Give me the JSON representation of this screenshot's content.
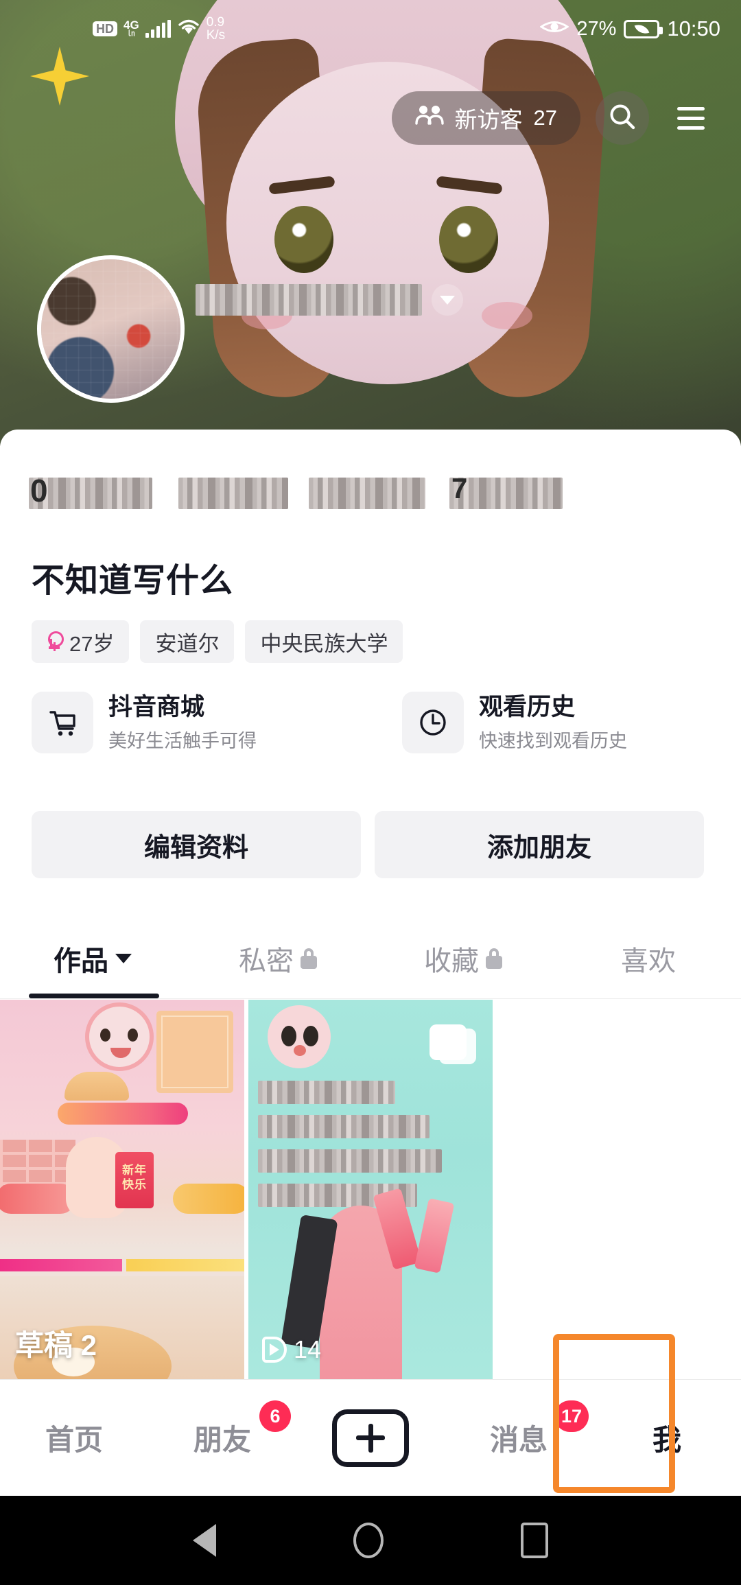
{
  "status_bar": {
    "hd_label": "HD",
    "network": "4G",
    "network_sub": "㏑",
    "speed_value": "0.9",
    "speed_unit": "K/s",
    "eye_icon": "eye-icon",
    "battery_percent": "27%",
    "battery_icon": "battery-eco-icon",
    "clock": "10:50"
  },
  "header": {
    "visitor_label": "新访客",
    "visitor_count": "27",
    "visitor_icon": "people-icon",
    "search_icon": "search-icon",
    "menu_icon": "hamburger-menu-icon",
    "username_masked": "",
    "username_caret_icon": "chevron-down-icon",
    "avatar_name": "profile-avatar"
  },
  "profile": {
    "stats_masked": [
      "",
      "",
      "",
      ""
    ],
    "stats_glyph_first": "0",
    "stats_glyph_last": "7",
    "bio": "不知道写什么",
    "tags": [
      {
        "icon": "female-gender-icon",
        "label": "27岁"
      },
      {
        "icon": "",
        "label": "安道尔"
      },
      {
        "icon": "",
        "label": "中央民族大学"
      }
    ]
  },
  "shortcuts": [
    {
      "icon": "shopping-cart-icon",
      "title": "抖音商城",
      "subtitle": "美好生活触手可得"
    },
    {
      "icon": "clock-icon",
      "title": "观看历史",
      "subtitle": "快速找到观看历史"
    }
  ],
  "actions": [
    {
      "label": "编辑资料"
    },
    {
      "label": "添加朋友"
    }
  ],
  "tabs": [
    {
      "label": "作品",
      "active": true,
      "icon": "chevron-down-icon",
      "locked": false
    },
    {
      "label": "私密",
      "active": false,
      "icon": "lock-icon",
      "locked": true
    },
    {
      "label": "收藏",
      "active": false,
      "icon": "lock-icon",
      "locked": true
    },
    {
      "label": "喜欢",
      "active": false,
      "icon": "",
      "locked": false
    }
  ],
  "grid": {
    "items": [
      {
        "label": "草稿 2",
        "type": "draft",
        "envelope_text": "新年\n快乐"
      },
      {
        "label": "14",
        "type": "video",
        "play_icon": "play-icon"
      }
    ]
  },
  "bottom_nav": {
    "items": [
      {
        "label": "首页",
        "badge": "",
        "active": false
      },
      {
        "label": "朋友",
        "badge": "6",
        "active": false
      },
      {
        "label": "",
        "badge": "",
        "active": false,
        "icon": "plus-icon"
      },
      {
        "label": "消息",
        "badge": "17",
        "active": false
      },
      {
        "label": "我",
        "badge": "",
        "active": true
      }
    ],
    "highlight_color": "#f5872b"
  },
  "system_nav": {
    "back_icon": "back-triangle-icon",
    "home_icon": "home-circle-icon",
    "recents_icon": "recents-square-icon"
  },
  "colors": {
    "accent_red": "#fe2c55",
    "text_primary": "#161823",
    "text_secondary": "#8a8a91",
    "chip_bg": "#f2f2f4",
    "highlight": "#f5872b"
  }
}
